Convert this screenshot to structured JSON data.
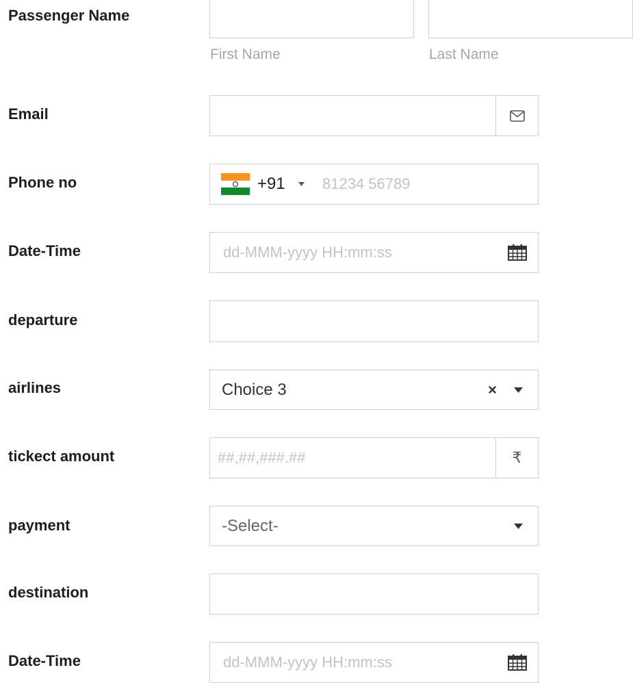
{
  "passenger_name": {
    "label": "Passenger Name",
    "first_name": {
      "value": "",
      "sublabel": "First Name"
    },
    "last_name": {
      "value": "",
      "sublabel": "Last Name"
    }
  },
  "email": {
    "label": "Email",
    "value": "",
    "icon": "envelope-icon"
  },
  "phone": {
    "label": "Phone no",
    "country_flag": "india-flag-icon",
    "dial_code": "+91",
    "placeholder": "81234 56789",
    "value": ""
  },
  "date_time_1": {
    "label": "Date-Time",
    "placeholder": "dd-MMM-yyyy HH:mm:ss",
    "value": "",
    "icon": "calendar-icon"
  },
  "departure": {
    "label": "departure",
    "value": ""
  },
  "airlines": {
    "label": "airlines",
    "selected": "Choice 3",
    "clear_glyph": "×"
  },
  "ticket_amount": {
    "label": "tickect amount",
    "placeholder": "##,##,###.##",
    "value": "",
    "currency_symbol": "₹"
  },
  "payment": {
    "label": "payment",
    "selected": "-Select-"
  },
  "destination": {
    "label": "destination",
    "value": ""
  },
  "date_time_2": {
    "label": "Date-Time",
    "placeholder": "dd-MMM-yyyy HH:mm:ss",
    "value": "",
    "icon": "calendar-icon"
  },
  "colors": {
    "border": "#cfcfcf",
    "label_text": "#1e1e1e",
    "placeholder": "#c3c3c3",
    "sublabel": "#a6a6a6"
  }
}
